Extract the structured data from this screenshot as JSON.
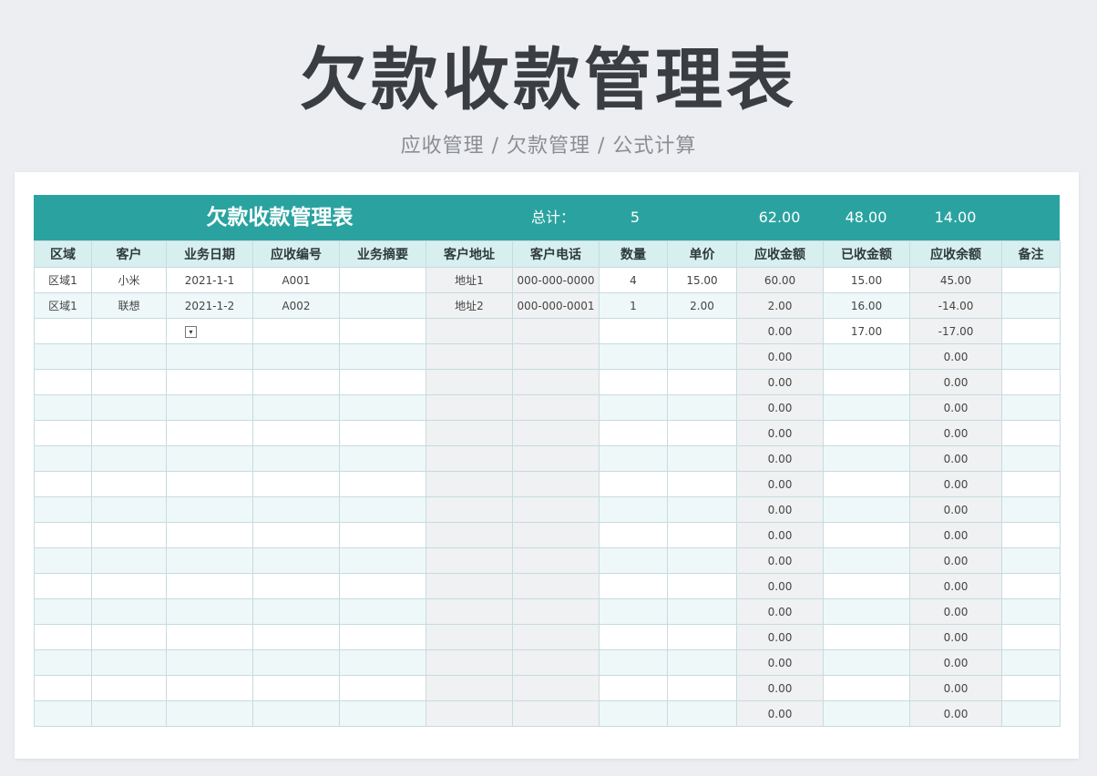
{
  "hero": {
    "title": "欠款收款管理表",
    "subtitle": "应收管理 / 欠款管理 / 公式计算"
  },
  "sheet": {
    "title": "欠款收款管理表",
    "total_label": "总计：",
    "total_count": "5",
    "total_receivable": "62.00",
    "total_received": "48.00",
    "total_balance": "14.00",
    "colors": {
      "banner": "#2aa3a0",
      "header": "#d8eff0",
      "band": "#eef8f9"
    },
    "columns": [
      "区域",
      "客户",
      "业务日期",
      "应收编号",
      "业务摘要",
      "客户地址",
      "客户电话",
      "数量",
      "单价",
      "应收金额",
      "已收金额",
      "应收余额",
      "备注"
    ],
    "rows": [
      [
        "区域1",
        "小米",
        "2021-1-1",
        "A001",
        "",
        "地址1",
        "000-000-0000",
        "4",
        "15.00",
        "60.00",
        "15.00",
        "45.00",
        ""
      ],
      [
        "区域1",
        "联想",
        "2021-1-2",
        "A002",
        "",
        "地址2",
        "000-000-0001",
        "1",
        "2.00",
        "2.00",
        "16.00",
        "-14.00",
        ""
      ],
      [
        "",
        "",
        "",
        "",
        "",
        "",
        "",
        "",
        "",
        "0.00",
        "17.00",
        "-17.00",
        ""
      ],
      [
        "",
        "",
        "",
        "",
        "",
        "",
        "",
        "",
        "",
        "0.00",
        "",
        "0.00",
        ""
      ],
      [
        "",
        "",
        "",
        "",
        "",
        "",
        "",
        "",
        "",
        "0.00",
        "",
        "0.00",
        ""
      ],
      [
        "",
        "",
        "",
        "",
        "",
        "",
        "",
        "",
        "",
        "0.00",
        "",
        "0.00",
        ""
      ],
      [
        "",
        "",
        "",
        "",
        "",
        "",
        "",
        "",
        "",
        "0.00",
        "",
        "0.00",
        ""
      ],
      [
        "",
        "",
        "",
        "",
        "",
        "",
        "",
        "",
        "",
        "0.00",
        "",
        "0.00",
        ""
      ],
      [
        "",
        "",
        "",
        "",
        "",
        "",
        "",
        "",
        "",
        "0.00",
        "",
        "0.00",
        ""
      ],
      [
        "",
        "",
        "",
        "",
        "",
        "",
        "",
        "",
        "",
        "0.00",
        "",
        "0.00",
        ""
      ],
      [
        "",
        "",
        "",
        "",
        "",
        "",
        "",
        "",
        "",
        "0.00",
        "",
        "0.00",
        ""
      ],
      [
        "",
        "",
        "",
        "",
        "",
        "",
        "",
        "",
        "",
        "0.00",
        "",
        "0.00",
        ""
      ],
      [
        "",
        "",
        "",
        "",
        "",
        "",
        "",
        "",
        "",
        "0.00",
        "",
        "0.00",
        ""
      ],
      [
        "",
        "",
        "",
        "",
        "",
        "",
        "",
        "",
        "",
        "0.00",
        "",
        "0.00",
        ""
      ],
      [
        "",
        "",
        "",
        "",
        "",
        "",
        "",
        "",
        "",
        "0.00",
        "",
        "0.00",
        ""
      ],
      [
        "",
        "",
        "",
        "",
        "",
        "",
        "",
        "",
        "",
        "0.00",
        "",
        "0.00",
        ""
      ],
      [
        "",
        "",
        "",
        "",
        "",
        "",
        "",
        "",
        "",
        "0.00",
        "",
        "0.00",
        ""
      ],
      [
        "",
        "",
        "",
        "",
        "",
        "",
        "",
        "",
        "",
        "0.00",
        "",
        "0.00",
        ""
      ]
    ],
    "dropdown_icon": "dropdown-arrow-icon"
  }
}
